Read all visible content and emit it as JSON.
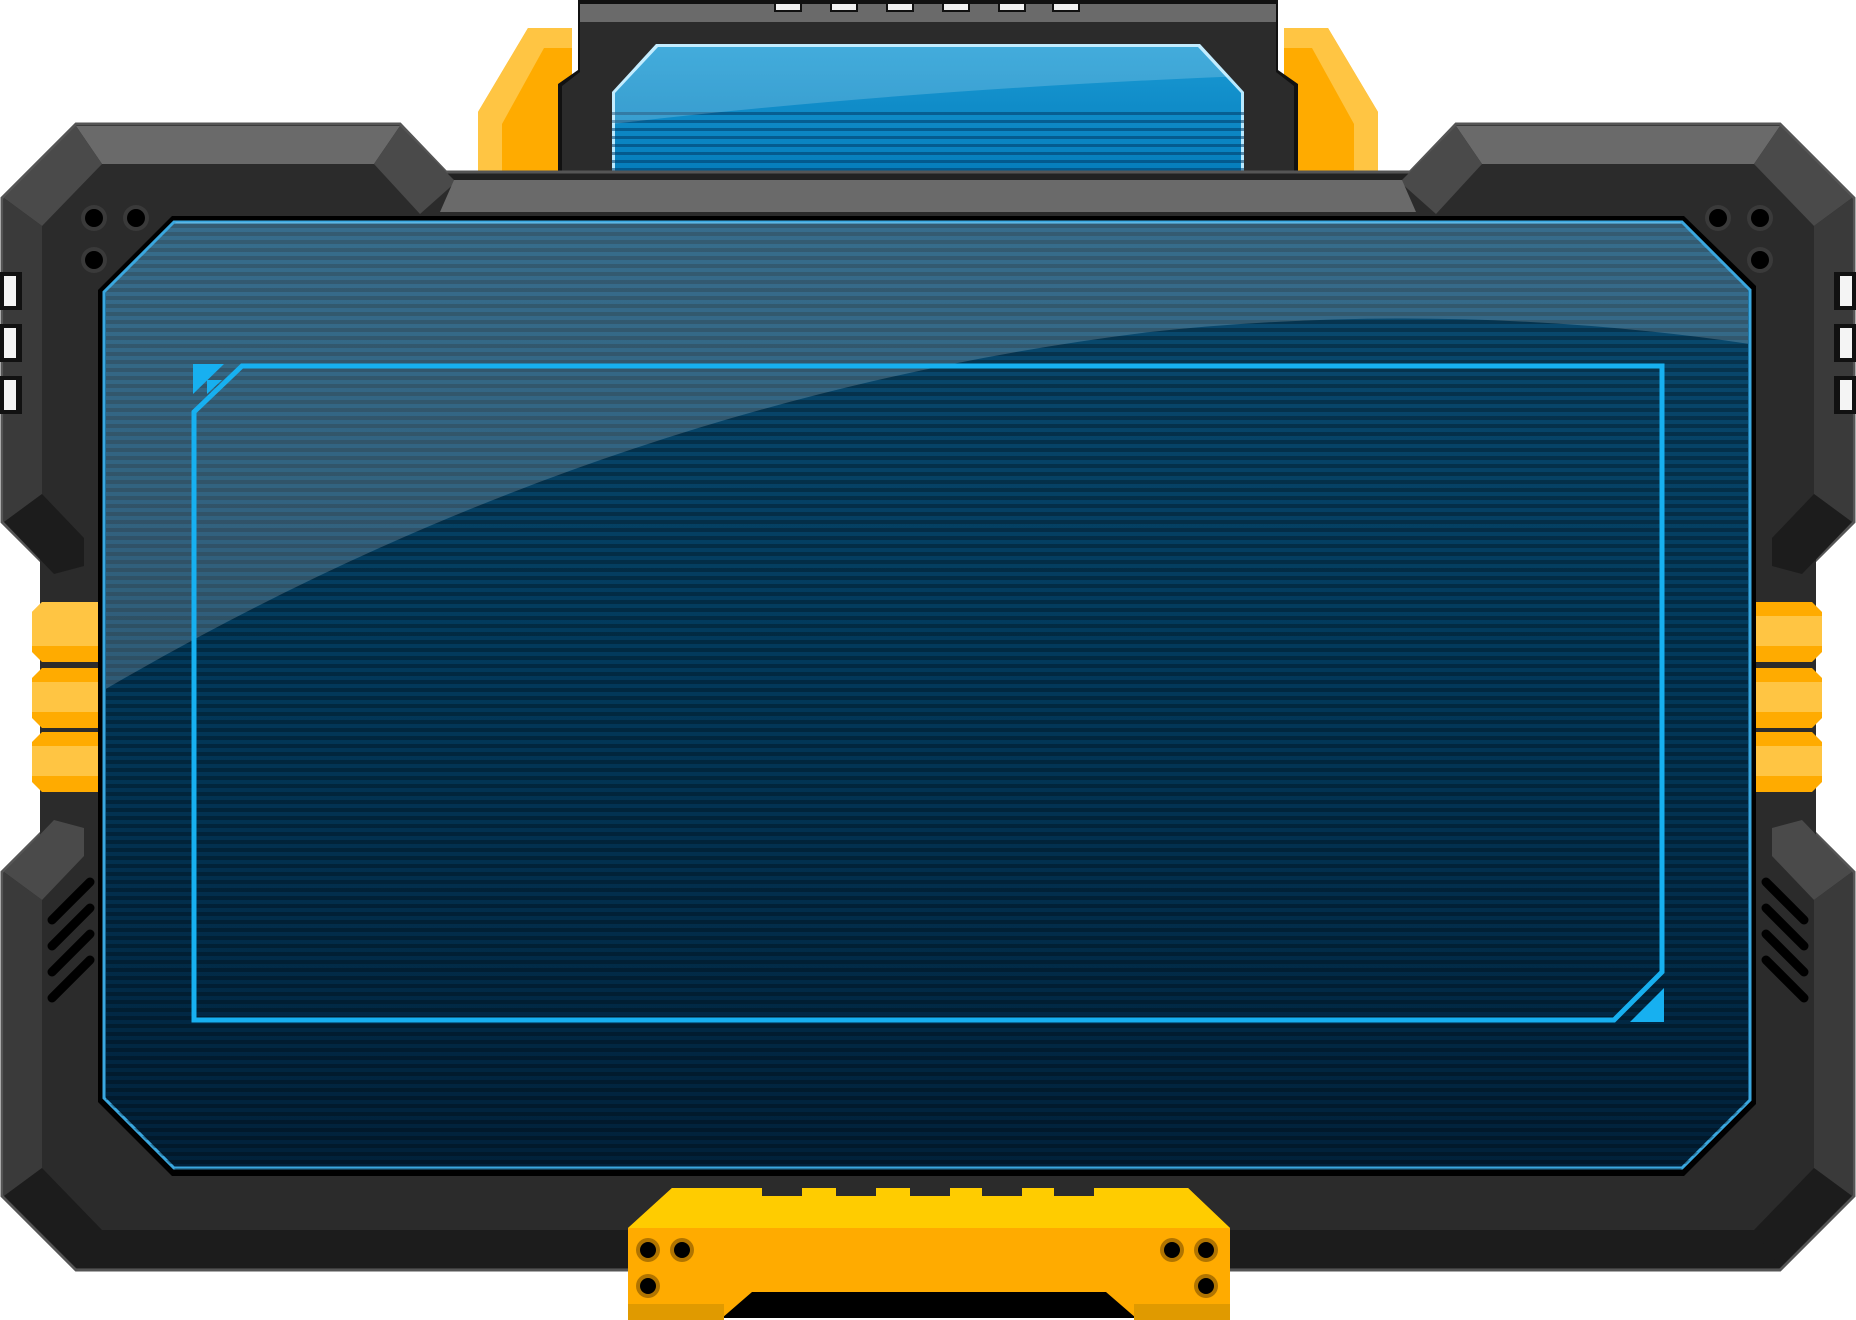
{
  "frame": {
    "style": "sci-fi game UI panel frame",
    "colors": {
      "body_dark": "#2b2b2b",
      "body_darker": "#1c1c1c",
      "bevel_light": "#6a6a6a",
      "bevel_mid": "#4a4a4a",
      "accent_orange": "#ffab00",
      "accent_orange_light": "#ffc543",
      "accent_yellow": "#ffcc00",
      "screen_top": "#3b6f8f",
      "screen_bottom": "#01213a",
      "screen_edge": "#3aa7df",
      "inner_frame": "#17b0f0",
      "top_screen": "#0a86c6"
    }
  },
  "main_screen": {
    "content": ""
  },
  "top_screen": {
    "content": ""
  },
  "icons": {
    "corner_screws": "screw-icon",
    "side_vents": "vent-slot-icon",
    "side_clips": "clip-bracket-icon",
    "bottom_handle": "handle-bracket-icon"
  }
}
